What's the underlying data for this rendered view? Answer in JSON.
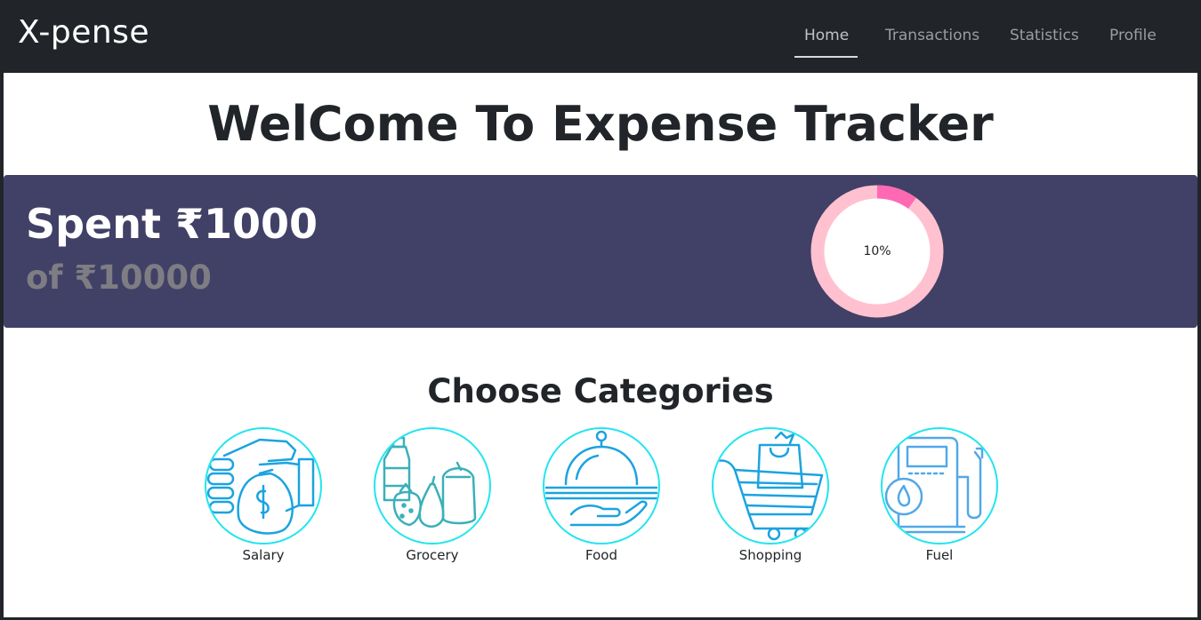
{
  "brand": "X-pense",
  "nav": {
    "items": [
      "Home",
      "Transactions",
      "Statistics",
      "Profile"
    ],
    "active": "Home"
  },
  "welcome_title": "WelCome To Expense Tracker",
  "summary": {
    "spent_text": "Spent ₹1000",
    "budget_text": "of ₹10000",
    "percent_label": "10%",
    "percent_value": 10,
    "colors": {
      "banner": "#414066",
      "ring_track": "#ffc1cf",
      "ring_fill": "#ff69b4"
    }
  },
  "categories_title": "Choose Categories",
  "categories": [
    {
      "label": "Salary",
      "icon": "salary-money-bag-icon"
    },
    {
      "label": "Grocery",
      "icon": "grocery-icon"
    },
    {
      "label": "Food",
      "icon": "food-cloche-icon"
    },
    {
      "label": "Shopping",
      "icon": "shopping-cart-icon"
    },
    {
      "label": "Fuel",
      "icon": "fuel-pump-icon"
    }
  ],
  "colors": {
    "navbar": "#212529",
    "category_border": "#22e5ef",
    "icon_blue": "#1ba3e0"
  }
}
